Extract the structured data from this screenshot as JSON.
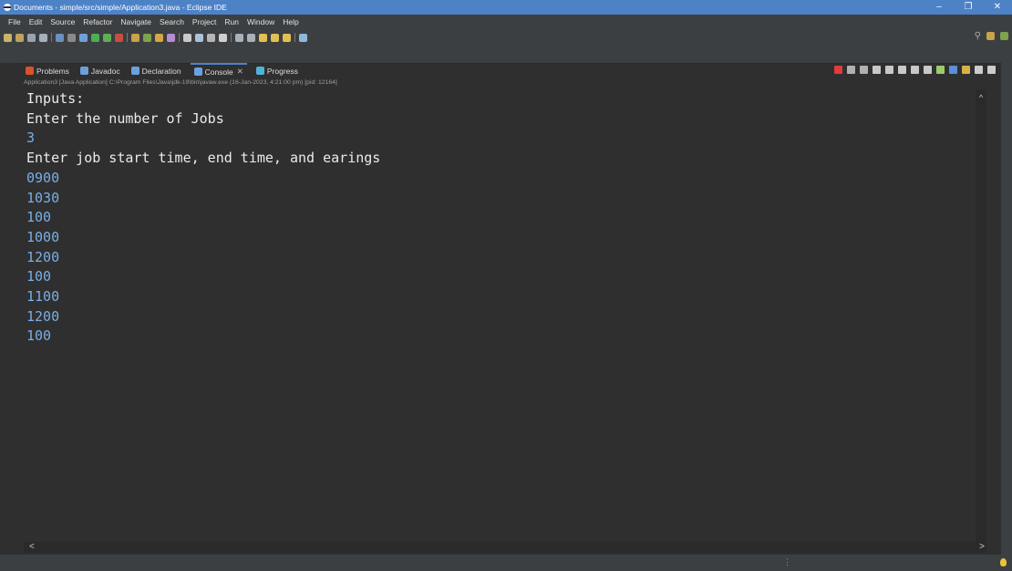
{
  "window": {
    "title": "Documents - simple/src/simple/Application3.java - Eclipse IDE",
    "controls": [
      "–",
      "❐",
      "✕"
    ]
  },
  "menu": [
    "File",
    "Edit",
    "Source",
    "Refactor",
    "Navigate",
    "Search",
    "Project",
    "Run",
    "Window",
    "Help"
  ],
  "tabs": [
    {
      "label": "Problems",
      "icon": "problems-icon",
      "color": "#d8542a"
    },
    {
      "label": "Javadoc",
      "icon": "javadoc-icon",
      "color": "#6f9fd8"
    },
    {
      "label": "Declaration",
      "icon": "declaration-icon",
      "color": "#6aa1e0"
    },
    {
      "label": "Console",
      "icon": "console-icon",
      "color": "#6aa1e0",
      "active": true,
      "close": "✕"
    },
    {
      "label": "Progress",
      "icon": "progress-icon",
      "color": "#4fb3d9"
    }
  ],
  "process_info": "Application3 [Java Application] C:\\Program Files\\Java\\jdk-19\\bin\\javaw.exe  (16-Jan-2023, 4:21:00 pm) [pid: 12164]",
  "console": {
    "lines": [
      {
        "text": "Inputs:",
        "kind": "out"
      },
      {
        "text": "Enter the number of Jobs",
        "kind": "out"
      },
      {
        "text": "3",
        "kind": "in"
      },
      {
        "text": "Enter job start time, end time, and earings",
        "kind": "out"
      },
      {
        "text": "0900",
        "kind": "in"
      },
      {
        "text": "1030",
        "kind": "in"
      },
      {
        "text": "100",
        "kind": "in"
      },
      {
        "text": "1000",
        "kind": "in"
      },
      {
        "text": "1200",
        "kind": "in"
      },
      {
        "text": "100",
        "kind": "in"
      },
      {
        "text": "1100",
        "kind": "in"
      },
      {
        "text": "1200",
        "kind": "in"
      },
      {
        "text": "100",
        "kind": "in"
      }
    ]
  },
  "colors": {
    "accent": "#4d82c7",
    "console_bg": "#2f2f2f",
    "output_text": "#ebebeb",
    "input_text": "#79aee6"
  }
}
